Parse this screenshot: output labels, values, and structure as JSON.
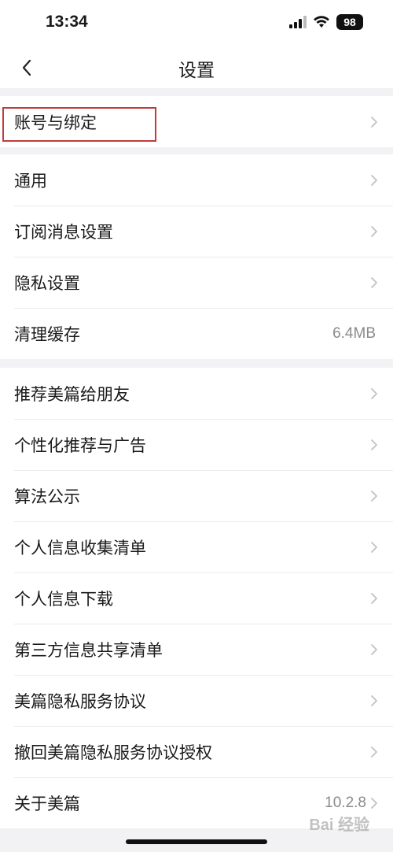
{
  "status_bar": {
    "time": "13:34",
    "battery": "98"
  },
  "nav": {
    "title": "设置"
  },
  "group1": [
    {
      "label": "账号与绑定"
    }
  ],
  "group2": [
    {
      "label": "通用"
    },
    {
      "label": "订阅消息设置"
    },
    {
      "label": "隐私设置"
    },
    {
      "label": "清理缓存",
      "value": "6.4MB"
    }
  ],
  "group3": [
    {
      "label": "推荐美篇给朋友"
    },
    {
      "label": "个性化推荐与广告"
    },
    {
      "label": "算法公示"
    },
    {
      "label": "个人信息收集清单"
    },
    {
      "label": "个人信息下载"
    },
    {
      "label": "第三方信息共享清单"
    },
    {
      "label": "美篇隐私服务协议"
    },
    {
      "label": "撤回美篇隐私服务协议授权"
    },
    {
      "label": "关于美篇",
      "value": "10.2.8"
    }
  ],
  "watermark": "Bai 经验",
  "colors": {
    "highlight": "#c23b3b",
    "background": "#f2f2f5"
  }
}
